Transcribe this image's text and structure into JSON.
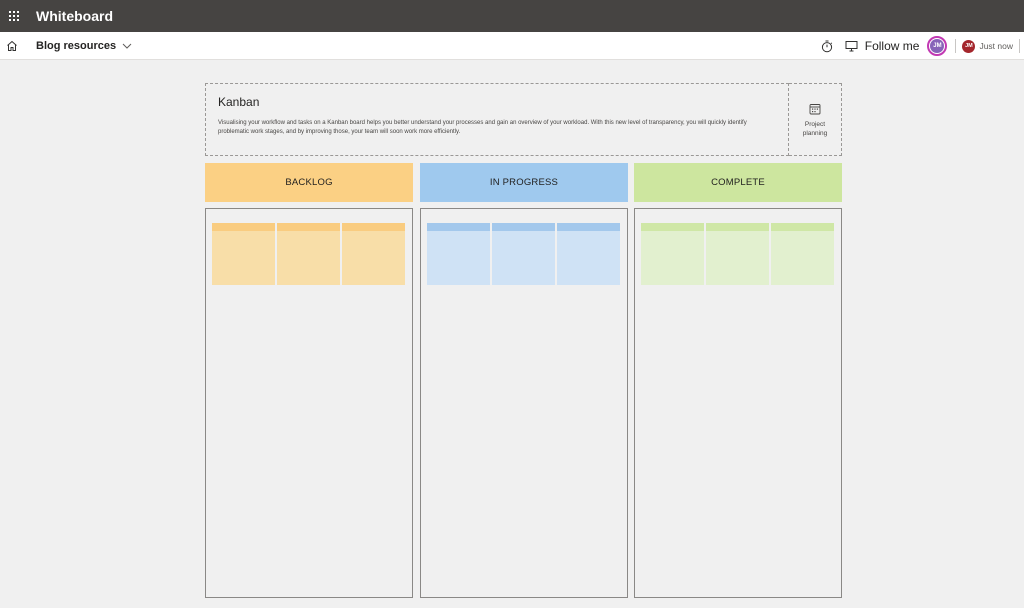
{
  "app": {
    "title": "Whiteboard"
  },
  "command_bar": {
    "board_name": "Blog resources",
    "follow_label": "Follow me",
    "user_initials": "JM",
    "collaborator_initials": "JM",
    "last_edit": "Just now"
  },
  "template": {
    "title": "Kanban",
    "description": "Visualising your workflow and tasks on a Kanban board helps you better understand your processes and gain an overview of your workload. With this new level of transparency, you will quickly identify problematic work stages, and by improving those, your team will soon work more efficiently.",
    "side_label": "Project planning"
  },
  "columns": [
    {
      "label": "BACKLOG",
      "header_color": "#fbd084",
      "note_band_color": "#f9cc80",
      "note_color": "#f8dea8",
      "notes": 3
    },
    {
      "label": "IN PROGRESS",
      "header_color": "#9fc9ee",
      "note_band_color": "#a3c8ec",
      "note_color": "#cfe2f5",
      "notes": 3
    },
    {
      "label": "COMPLETE",
      "header_color": "#cde69f",
      "note_band_color": "#cfe7a6",
      "note_color": "#e2f0cf",
      "notes": 3
    }
  ],
  "icons": {
    "app_launcher": "waffle-icon",
    "home": "home-icon",
    "dropdown": "chevron-down-icon",
    "timer": "timer-icon",
    "follow": "present-icon",
    "planning": "calendar-icon"
  }
}
